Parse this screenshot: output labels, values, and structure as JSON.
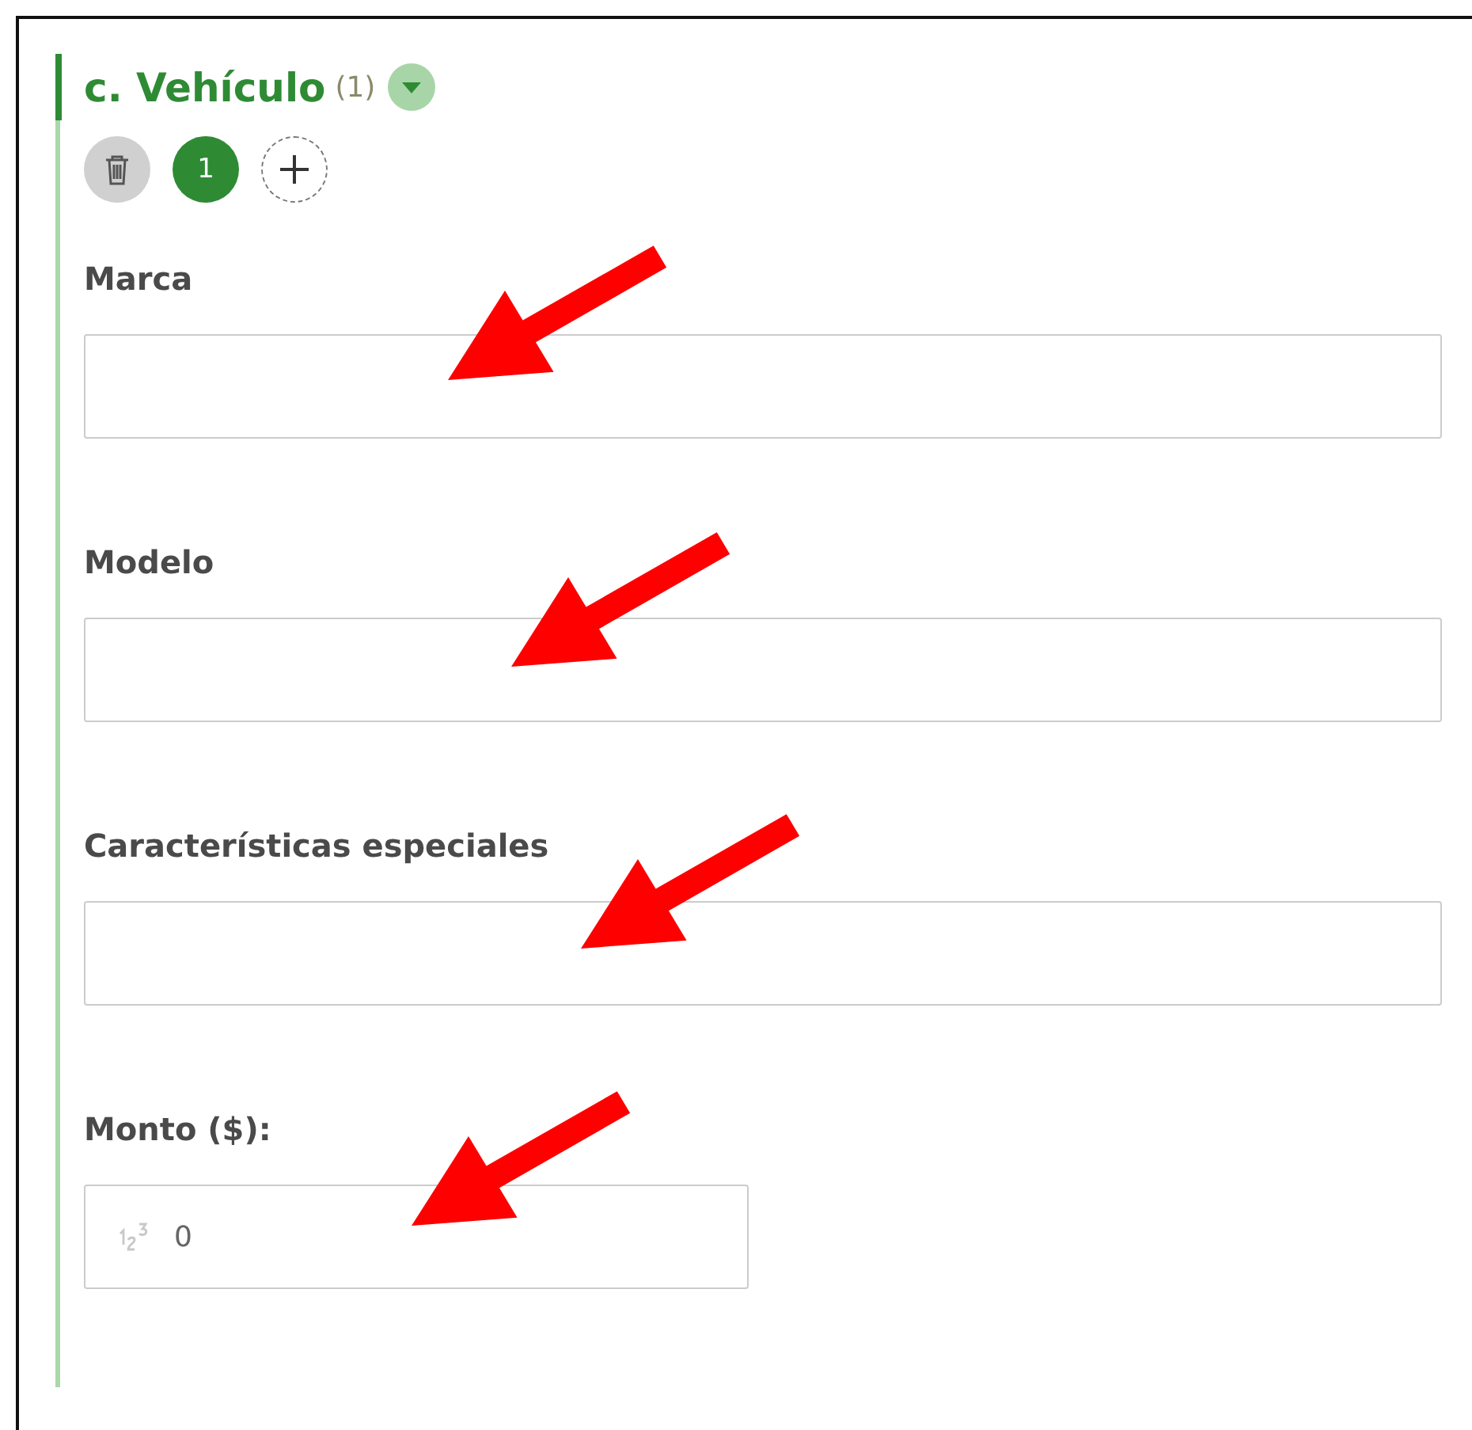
{
  "section": {
    "title": "c. Vehículo",
    "count": "(1)",
    "expanded": true
  },
  "instances": [
    {
      "label": "1",
      "selected": true
    }
  ],
  "fields": [
    {
      "label": "Marca",
      "kind": "text",
      "arrow": true
    },
    {
      "label": "Modelo",
      "kind": "text",
      "arrow": true
    },
    {
      "label": "Características especiales",
      "kind": "text",
      "arrow": true
    },
    {
      "label": "Monto ($):",
      "kind": "number",
      "value": "0",
      "arrow": true
    }
  ]
}
